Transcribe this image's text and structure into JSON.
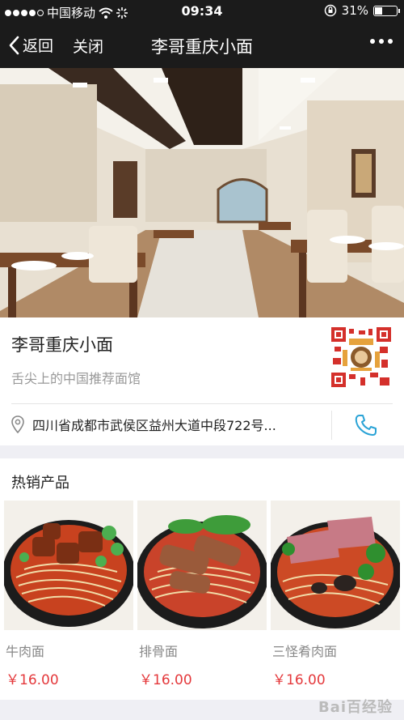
{
  "status_bar": {
    "carrier": "中国移动",
    "time": "09:34",
    "battery": "31%",
    "battery_level": 0.31
  },
  "nav": {
    "back_label": "返回",
    "close_label": "关闭",
    "title": "李哥重庆小面"
  },
  "store": {
    "name": "李哥重庆小面",
    "slogan": "舌尖上的中国推荐面馆",
    "address": "四川省成都市武侯区益州大道中段722号..."
  },
  "hot_products": {
    "title": "热销产品",
    "items": [
      {
        "name": "牛肉面",
        "price": "￥16.00"
      },
      {
        "name": "排骨面",
        "price": "￥16.00"
      },
      {
        "name": "三怪肴肉面",
        "price": "￥16.00"
      }
    ]
  },
  "colors": {
    "bar_bg": "#1b1b1b",
    "price": "#e4393c",
    "phone_icon": "#2aa3d6"
  },
  "watermark": "Bai百经验"
}
